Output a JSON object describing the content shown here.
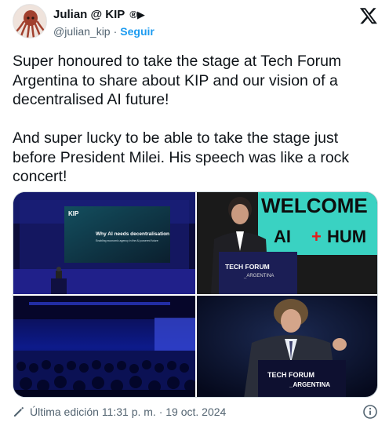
{
  "author": {
    "display_name": "Julian @ KIP",
    "badge_glyphs": "®▶",
    "handle": "@julian_kip",
    "separator": "·",
    "follow_label": "Seguir"
  },
  "tweet": {
    "text": "Super honoured to take the stage at Tech Forum Argentina to share about KIP and our vision of a decentralised AI future!\n\nAnd super lucky to be able to take the stage just before President Milei. His speech was like a rock concert!"
  },
  "media": {
    "photo1": {
      "screen_logo": "KIP",
      "slide_title": "Why AI needs decentralisation",
      "slide_sub": "Enabling economic agency in the AI powered future"
    },
    "photo2": {
      "screen_line1": "WELCOME",
      "screen_line2_a": "AI",
      "screen_line2_plus": "+",
      "screen_line2_b": "HUM",
      "podium_line1": "TECH FORUM",
      "podium_line2": "_ARGENTINA"
    },
    "photo4": {
      "podium_line1": "TECH FORUM",
      "podium_line2": "_ARGENTINA"
    }
  },
  "footer": {
    "edited_label": "Última edición 11:31 p. m. · 19 oct. 2024"
  },
  "icons": {
    "brand": "x-logo-icon",
    "edit": "pencil-icon",
    "info": "info-icon"
  },
  "colors": {
    "link": "#1d9bf0",
    "text": "#0f1419",
    "secondary": "#536471"
  }
}
